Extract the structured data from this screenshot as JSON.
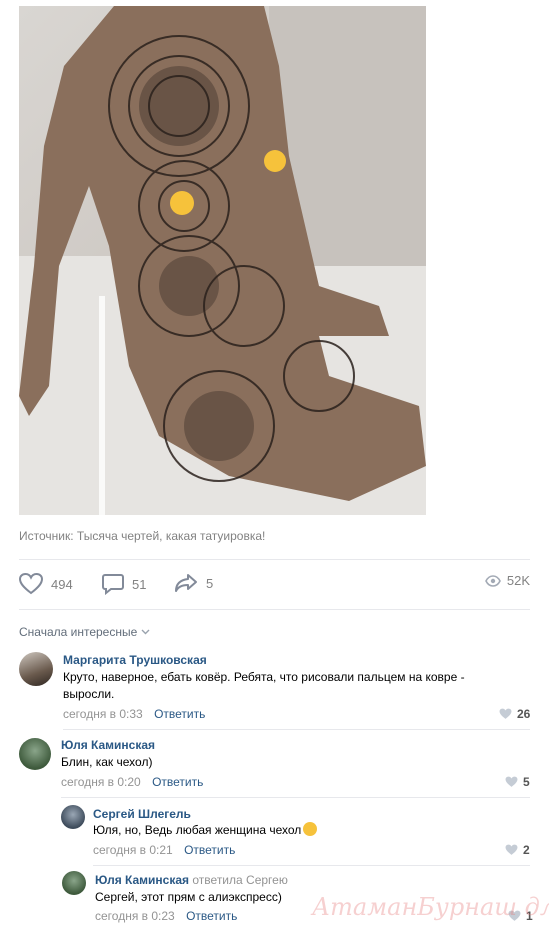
{
  "post": {
    "source_caption": "Источник: Тысяча чертей, какая татуировка!",
    "likes": "494",
    "comments": "51",
    "shares": "5",
    "views": "52K"
  },
  "comments_header": {
    "sort_label": "Сначала интересные"
  },
  "comments": [
    {
      "author": "Маргарита Трушковская",
      "text": "Круто, наверное, ебать ковёр. Ребята, что рисовали пальцем на ковре - выросли.",
      "time": "сегодня в 0:33",
      "reply_label": "Ответить",
      "likes": "26"
    },
    {
      "author": "Юля Каминская",
      "text": "Блин, как чехол)",
      "time": "сегодня в 0:20",
      "reply_label": "Ответить",
      "likes": "5"
    },
    {
      "author": "Сергей Шлегель",
      "text": "Юля, но, Ведь любая женщина чехол",
      "time": "сегодня в 0:21",
      "reply_label": "Ответить",
      "likes": "2"
    },
    {
      "author": "Юля Каминская",
      "reply_to": "ответила Сергею",
      "text": "Сергей, этот прям с алиэкспресс)",
      "time": "сегодня в 0:23",
      "reply_label": "Ответить",
      "likes": "1"
    }
  ],
  "watermark": "АтаманБурнаш для ЯП",
  "colors": {
    "link": "#2a5885",
    "meta": "#939393",
    "divider": "#e7e8ec"
  },
  "icons": [
    "heart-icon",
    "comment-icon",
    "share-icon",
    "eye-icon",
    "chevron-down-icon"
  ]
}
